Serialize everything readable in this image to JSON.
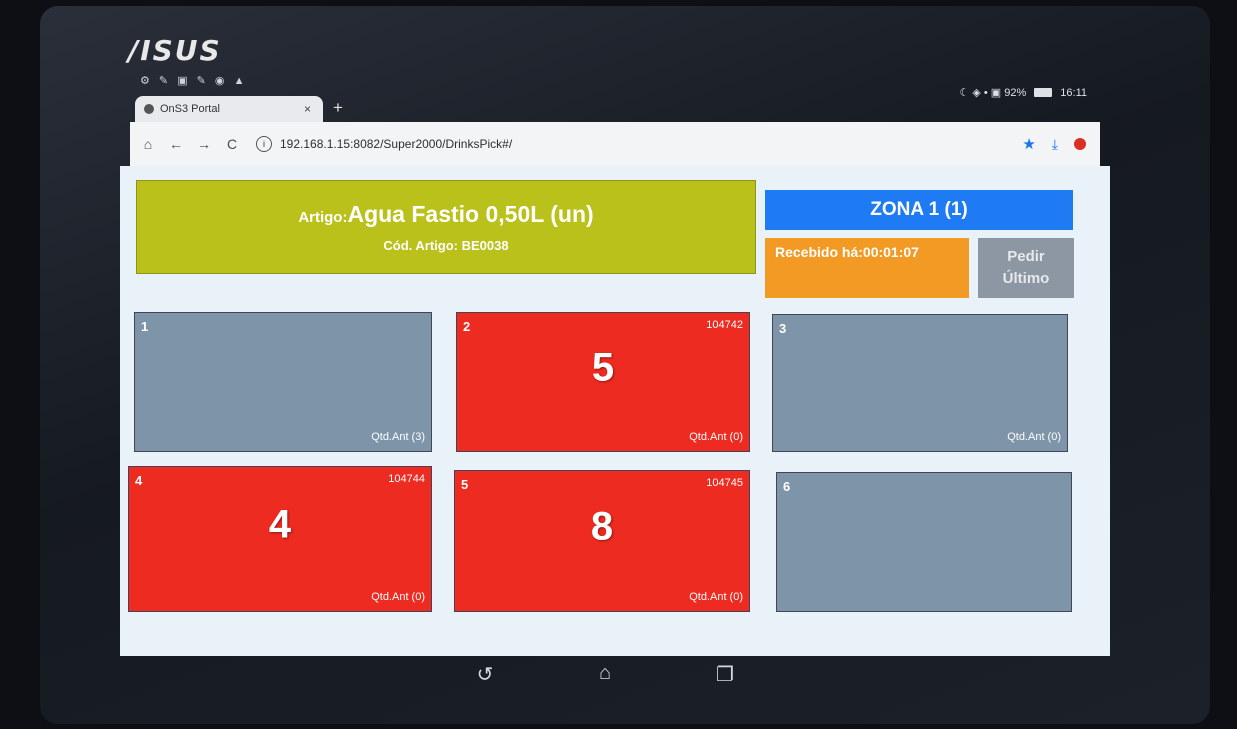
{
  "device": {
    "brand": "/ISUS"
  },
  "status_bar": {
    "left_icons": "⚙ ✎ ▣ ✎ ◉ ▲",
    "right_text": "☾ ◈ • ▣ 92%",
    "time": "16:11"
  },
  "browser": {
    "tab_title": "OnS3 Portal",
    "tab_close": "×",
    "new_tab": "+",
    "url": "192.168.1.15:8082/Super2000/DrinksPick#/",
    "nav": {
      "home": "⌂",
      "back": "←",
      "forward": "→",
      "reload": "C"
    },
    "icons": {
      "star": "★",
      "download": "⤓"
    }
  },
  "article": {
    "label": "Artigo:",
    "name": "Agua Fastio 0,50L (un)",
    "code_label": "Cód. Artigo: ",
    "code": "BE0038"
  },
  "zone": {
    "label": "ZONA 1 (1)"
  },
  "received": {
    "label": "Recebido há:",
    "time": "00:01:07"
  },
  "request_last": {
    "line1": "Pedir",
    "line2": "Último"
  },
  "cells": [
    {
      "num": "1",
      "code": "",
      "qty": "",
      "qtd_ant": "Qtd.Ant (3)",
      "color": "#7e94a8"
    },
    {
      "num": "2",
      "code": "104742",
      "qty": "5",
      "qtd_ant": "Qtd.Ant (0)",
      "color": "#ee2b20"
    },
    {
      "num": "3",
      "code": "",
      "qty": "",
      "qtd_ant": "Qtd.Ant (0)",
      "color": "#7e94a8"
    },
    {
      "num": "4",
      "code": "104744",
      "qty": "4",
      "qtd_ant": "Qtd.Ant (0)",
      "color": "#ee2b20"
    },
    {
      "num": "5",
      "code": "104745",
      "qty": "8",
      "qtd_ant": "Qtd.Ant (0)",
      "color": "#ee2b20"
    },
    {
      "num": "6",
      "code": "",
      "qty": "",
      "qtd_ant": "",
      "color": "#7e94a8"
    }
  ],
  "softkeys": {
    "back": "↺",
    "home": "⌂",
    "recents": "❐"
  }
}
